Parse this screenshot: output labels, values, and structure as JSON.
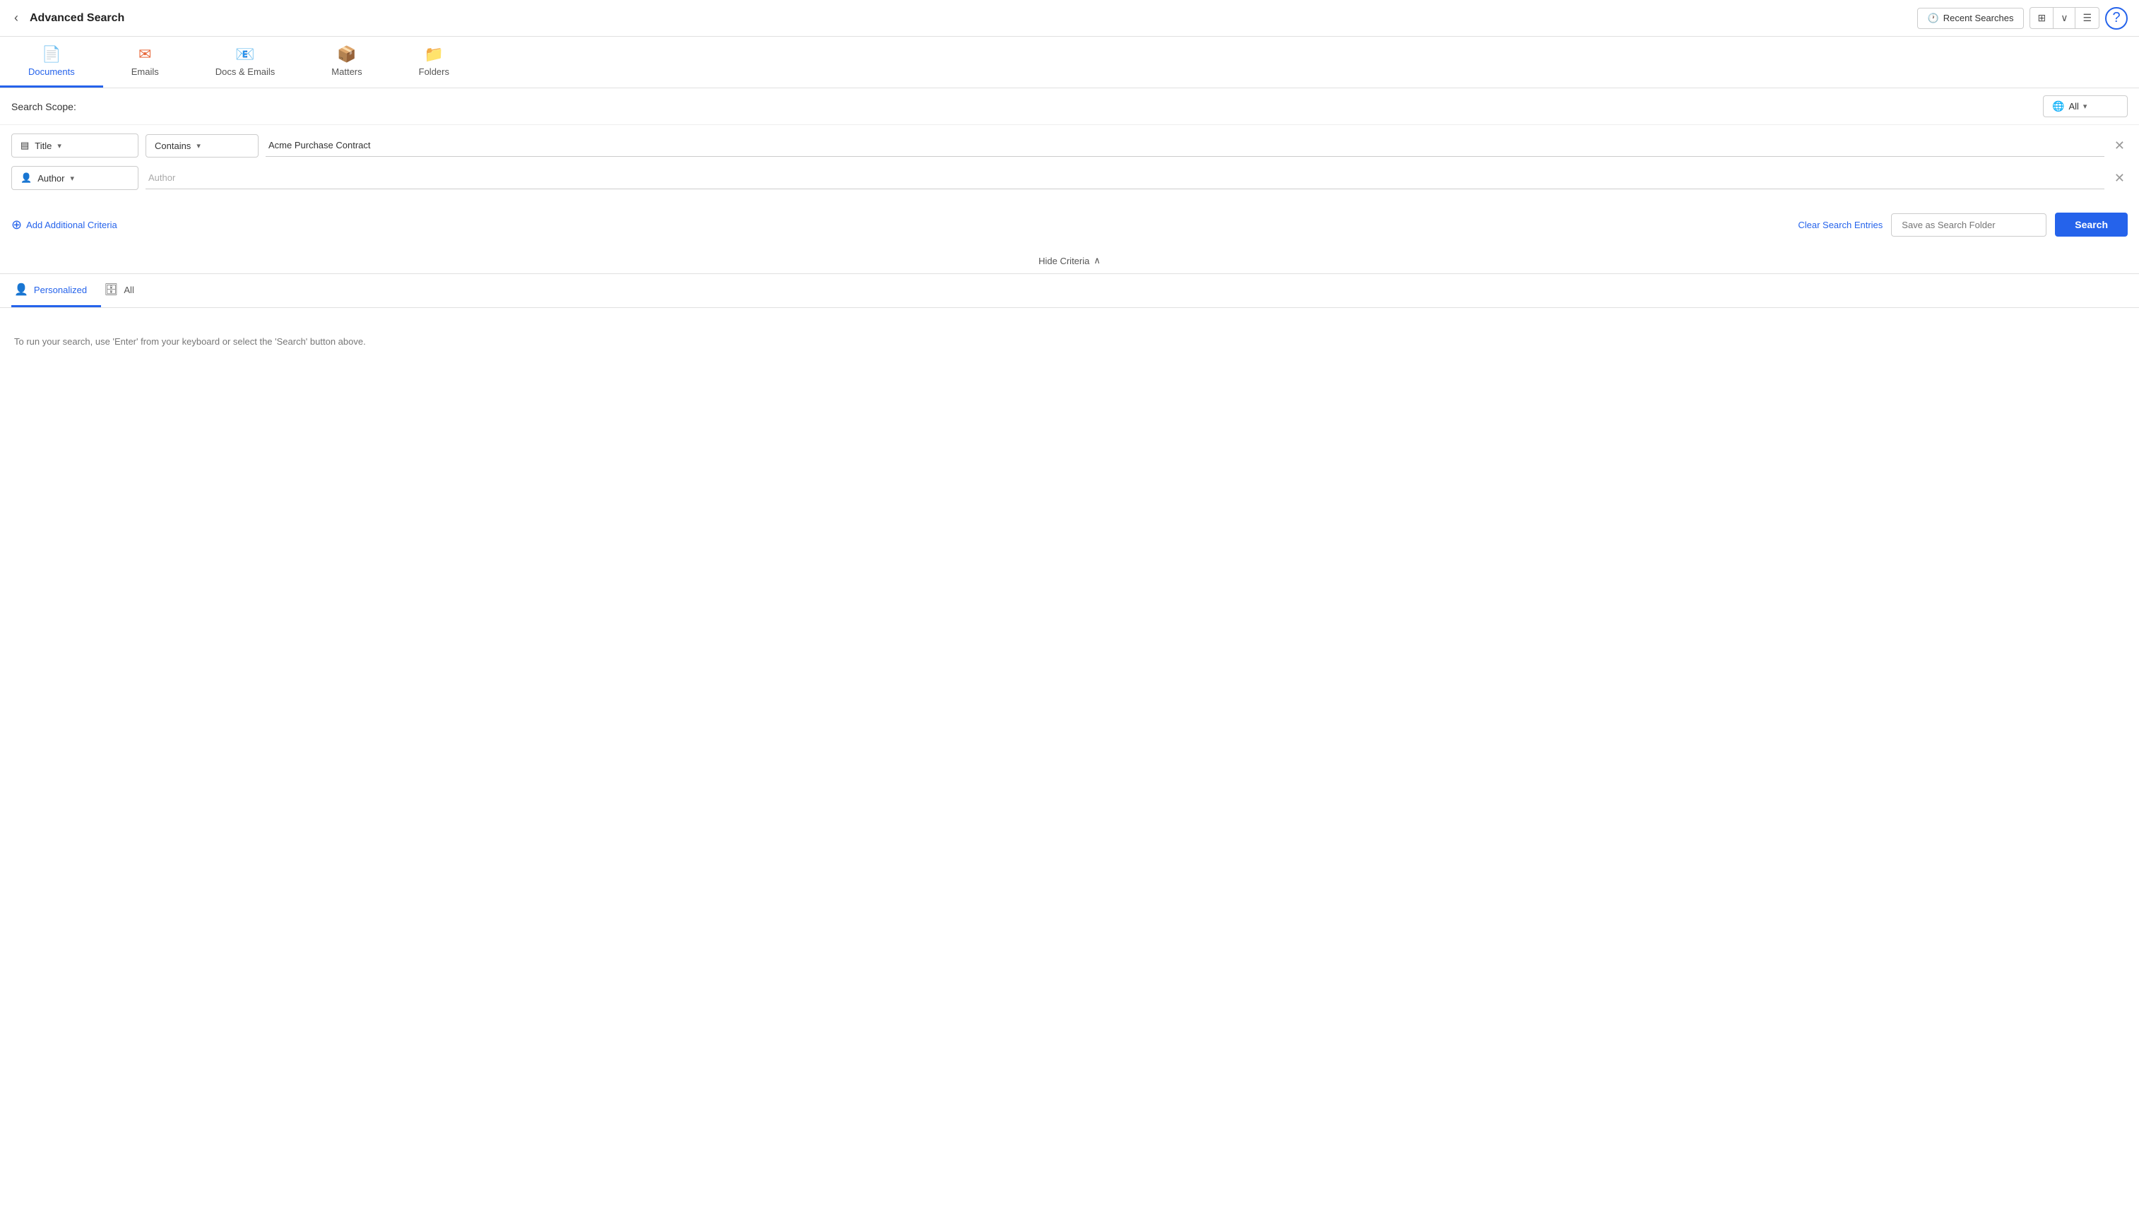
{
  "header": {
    "back_label": "‹",
    "title": "Advanced Search",
    "recent_searches_label": "Recent Searches",
    "help_label": "?"
  },
  "tabs": [
    {
      "id": "documents",
      "label": "Documents",
      "icon": "📄",
      "active": true
    },
    {
      "id": "emails",
      "label": "Emails",
      "icon": "✉",
      "active": false
    },
    {
      "id": "docs-emails",
      "label": "Docs & Emails",
      "icon": "📧",
      "active": false
    },
    {
      "id": "matters",
      "label": "Matters",
      "icon": "📦",
      "active": false
    },
    {
      "id": "folders",
      "label": "Folders",
      "icon": "📁",
      "active": false
    }
  ],
  "search_scope": {
    "label": "Search Scope:",
    "value": "All"
  },
  "criteria": [
    {
      "field": "Title",
      "condition": "Contains",
      "value": "Acme Purchase Contract",
      "placeholder": ""
    },
    {
      "field": "Author",
      "condition": "",
      "value": "",
      "placeholder": "Author"
    }
  ],
  "actions": {
    "add_criteria_label": "Add Additional Criteria",
    "clear_label": "Clear Search Entries",
    "save_folder_placeholder": "Save as Search Folder",
    "search_label": "Search"
  },
  "hide_criteria_label": "Hide Criteria",
  "result_tabs": [
    {
      "id": "personalized",
      "label": "Personalized",
      "active": true
    },
    {
      "id": "all",
      "label": "All",
      "active": false
    }
  ],
  "empty_state_message": "To run your search, use 'Enter' from your keyboard or select the 'Search' button above."
}
